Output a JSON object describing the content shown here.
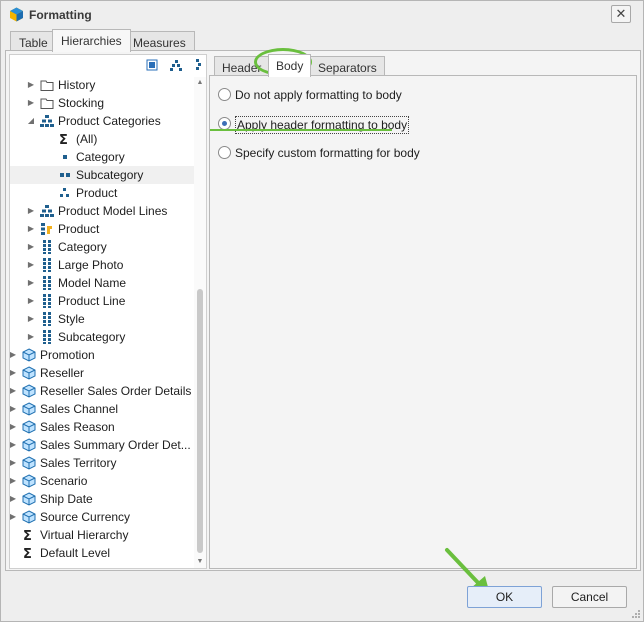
{
  "window": {
    "title": "Formatting",
    "close_label": "✕"
  },
  "top_tabs": [
    {
      "label": "Table"
    },
    {
      "label": "Hierarchies"
    },
    {
      "label": "Measures"
    }
  ],
  "tree": {
    "items": [
      {
        "label": "History",
        "icon": "folder-icon"
      },
      {
        "label": "Stocking",
        "icon": "folder-icon"
      },
      {
        "label": "Product Categories",
        "icon": "hierarchy-icon"
      },
      {
        "label": "(All)",
        "icon": "sigma-icon"
      },
      {
        "label": "Category",
        "icon": "level-1-icon"
      },
      {
        "label": "Subcategory",
        "icon": "level-2-icon"
      },
      {
        "label": "Product",
        "icon": "level-3-icon"
      },
      {
        "label": "Product Model Lines",
        "icon": "hierarchy-icon"
      },
      {
        "label": "Product",
        "icon": "hierarchy-key-icon"
      },
      {
        "label": "Category",
        "icon": "attribute-icon"
      },
      {
        "label": "Large Photo",
        "icon": "attribute-icon"
      },
      {
        "label": "Model Name",
        "icon": "attribute-icon"
      },
      {
        "label": "Product Line",
        "icon": "attribute-icon"
      },
      {
        "label": "Style",
        "icon": "attribute-icon"
      },
      {
        "label": "Subcategory",
        "icon": "attribute-icon"
      },
      {
        "label": "Promotion",
        "icon": "dimension-icon"
      },
      {
        "label": "Reseller",
        "icon": "dimension-icon"
      },
      {
        "label": "Reseller Sales Order Details",
        "icon": "dimension-icon"
      },
      {
        "label": "Sales Channel",
        "icon": "dimension-icon"
      },
      {
        "label": "Sales Reason",
        "icon": "dimension-icon"
      },
      {
        "label": "Sales Summary Order Det...",
        "icon": "dimension-icon"
      },
      {
        "label": "Sales Territory",
        "icon": "dimension-icon"
      },
      {
        "label": "Scenario",
        "icon": "dimension-icon"
      },
      {
        "label": "Ship Date",
        "icon": "dimension-icon"
      },
      {
        "label": "Source Currency",
        "icon": "dimension-icon"
      },
      {
        "label": "Virtual Hierarchy",
        "icon": "sigma-icon"
      },
      {
        "label": "Default Level",
        "icon": "sigma-icon"
      }
    ],
    "selected": "Subcategory"
  },
  "inner_tabs": [
    {
      "label": "Header"
    },
    {
      "label": "Body"
    },
    {
      "label": "Separators"
    }
  ],
  "body_options": [
    {
      "label": "Do not apply formatting to body",
      "checked": false
    },
    {
      "label": "Apply header formatting to body",
      "checked": true
    },
    {
      "label": "Specify custom formatting for body",
      "checked": false
    }
  ],
  "buttons": {
    "ok": "OK",
    "cancel": "Cancel"
  },
  "colors": {
    "highlight": "#6abf3e",
    "radio_accent": "#3d6fb6",
    "ok_border": "#7ea2d6"
  }
}
